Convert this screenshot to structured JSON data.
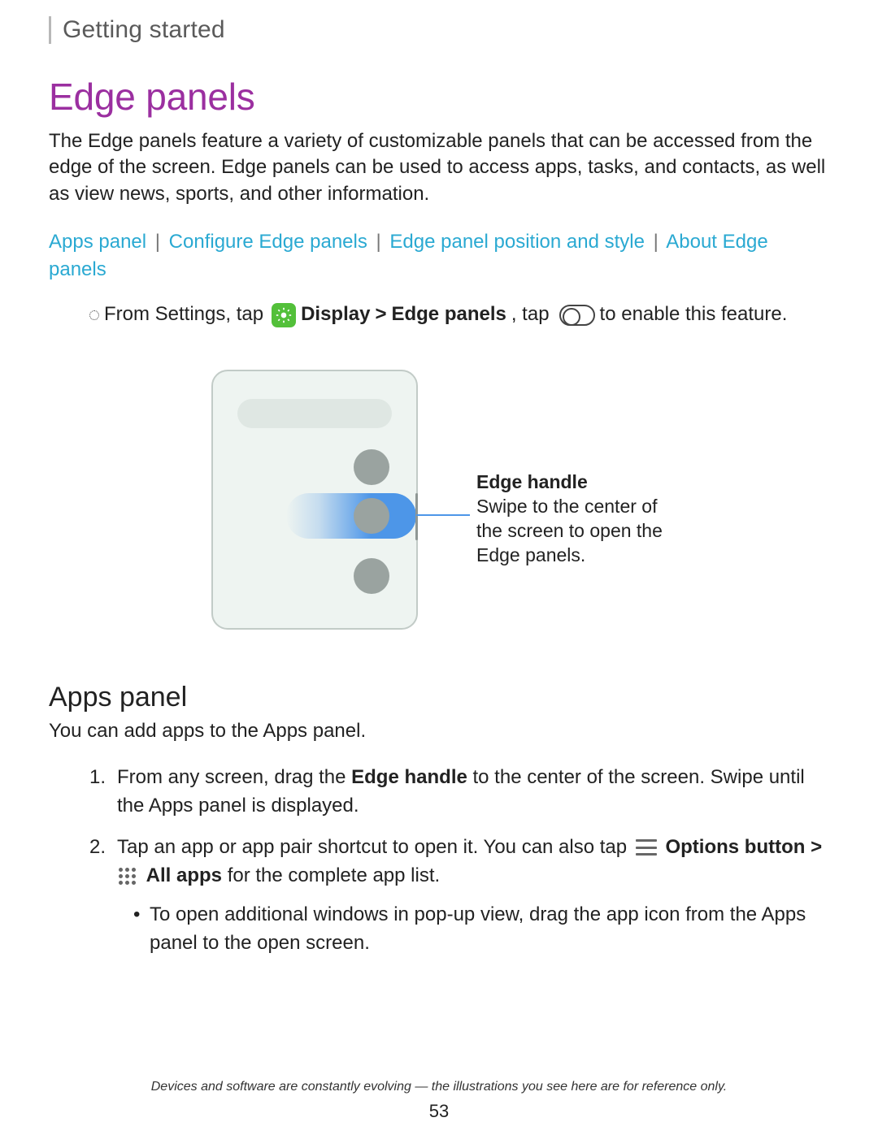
{
  "breadcrumb": "Getting started",
  "title": "Edge panels",
  "intro": "The Edge panels feature a variety of customizable panels that can be accessed from the edge of the screen. Edge panels can be used to access apps, tasks, and contacts, as well as view news, sports, and other information.",
  "links": {
    "a": "Apps panel",
    "b": "Configure Edge panels",
    "c": "Edge panel position and style",
    "d": "About Edge panels",
    "sep": "|"
  },
  "step_enable": {
    "pre": "From Settings, tap",
    "display_bold": "Display",
    "gt": ">",
    "edge_bold": "Edge panels",
    "mid": ", tap",
    "post": "to enable this feature."
  },
  "callout": {
    "title": "Edge handle",
    "body": "Swipe to the center of the screen to open the Edge panels."
  },
  "apps_panel": {
    "heading": "Apps panel",
    "intro": "You can add apps to the Apps panel.",
    "step1_num": "1.",
    "step1_a": "From any screen, drag the ",
    "step1_bold": "Edge handle",
    "step1_b": " to the center of the screen. Swipe until the Apps panel is displayed.",
    "step2_num": "2.",
    "step2_a": "Tap an app or app pair shortcut to open it. You can also tap",
    "step2_options": "Options button",
    "step2_gt": ">",
    "step2_allapps": "All apps",
    "step2_b": " for the complete app list.",
    "sub": "To open additional windows in pop-up view, drag the app icon from the Apps panel to the open screen."
  },
  "footer": "Devices and software are constantly evolving — the illustrations you see here are for reference only.",
  "page": "53"
}
